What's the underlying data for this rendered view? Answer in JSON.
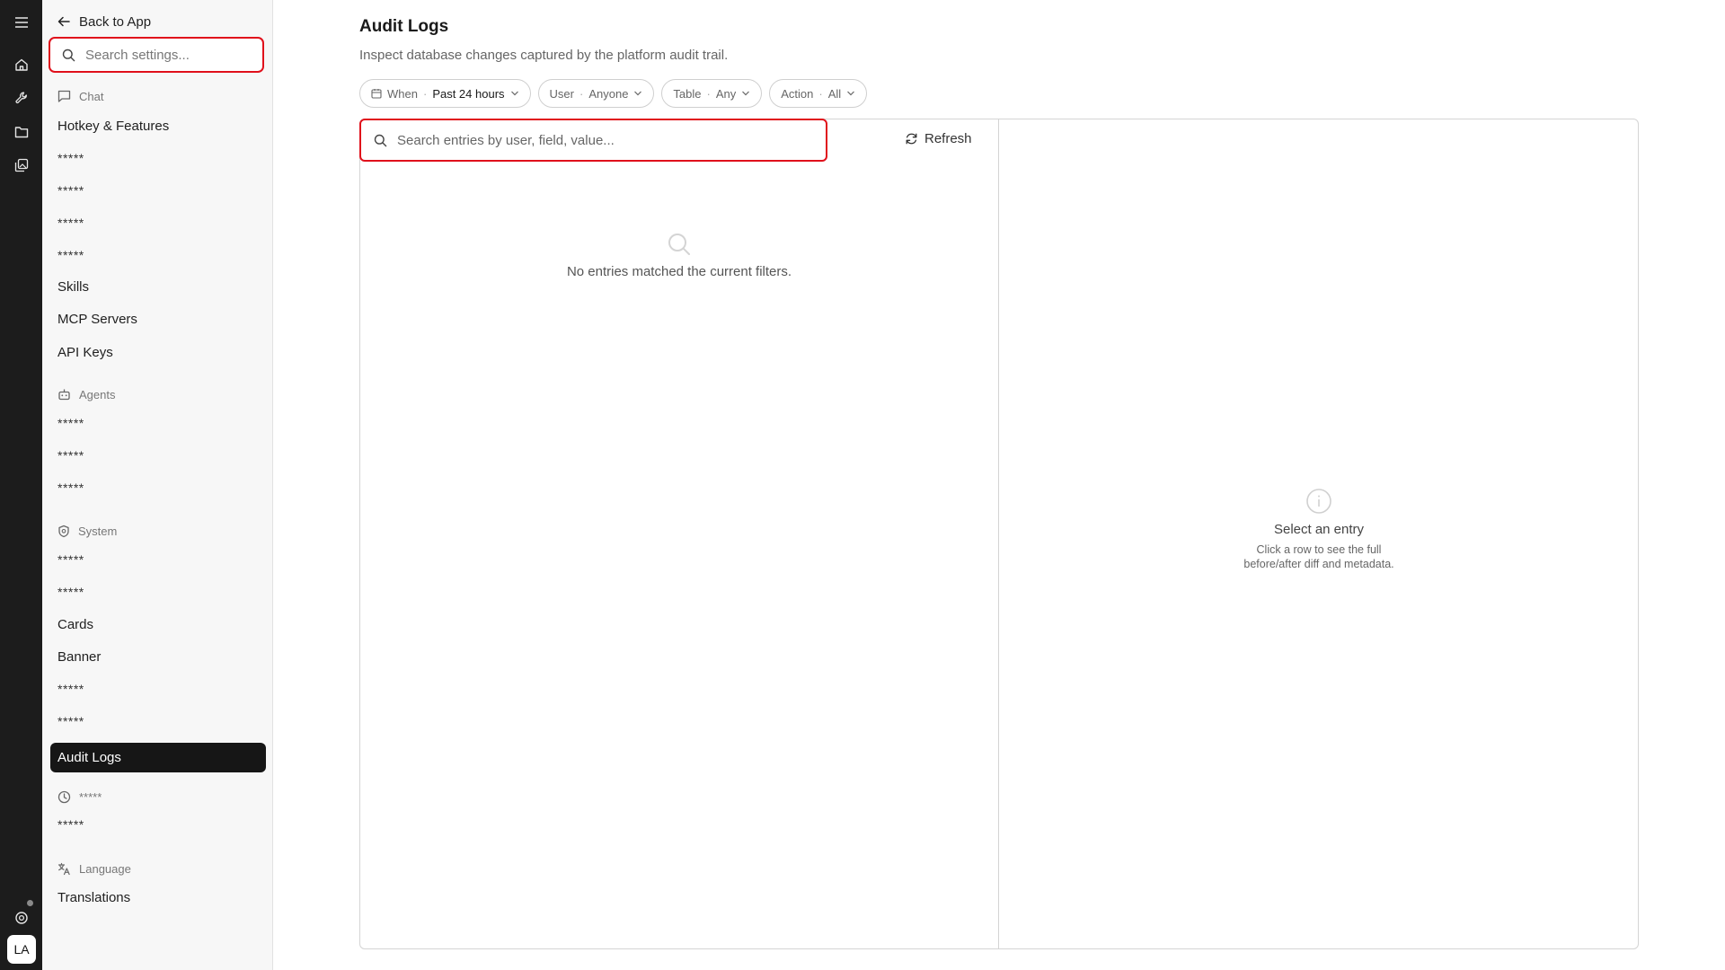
{
  "rail": {
    "icons": [
      "menu-icon",
      "home-icon",
      "wrench-icon",
      "folder-icon",
      "gallery-icon"
    ],
    "help_icon": "help-icon",
    "avatar_initials": "LA"
  },
  "sidebar": {
    "back_label": "Back to App",
    "search_placeholder": "Search settings...",
    "sections": [
      {
        "label": "Chat",
        "icon": "chat-icon",
        "items": [
          "Hotkey & Features",
          "*****",
          "*****",
          "*****",
          "*****",
          "Skills",
          "MCP Servers",
          "API Keys"
        ]
      },
      {
        "label": "Agents",
        "icon": "robot-icon",
        "items": [
          "*****",
          "*****",
          "*****"
        ]
      },
      {
        "label": "System",
        "icon": "shield-icon",
        "items": [
          "*****",
          "*****",
          "Cards",
          "Banner",
          "*****",
          "*****",
          "Audit Logs"
        ]
      },
      {
        "label": "*****",
        "icon": "clock-icon",
        "items": [
          "*****"
        ]
      },
      {
        "label": "Language",
        "icon": "translate-icon",
        "items": [
          "Translations"
        ]
      }
    ],
    "active_item": "Audit Logs"
  },
  "main": {
    "title": "Audit Logs",
    "subtitle": "Inspect database changes captured by the platform audit trail.",
    "filters": [
      {
        "label": "When",
        "value": "Past 24 hours",
        "icon": "calendar-icon"
      },
      {
        "label": "User",
        "value": "Anyone"
      },
      {
        "label": "Table",
        "value": "Any"
      },
      {
        "label": "Action",
        "value": "All"
      }
    ],
    "list": {
      "search_placeholder": "Search entries by user, field, value...",
      "refresh_label": "Refresh",
      "empty_text": "No entries matched the current filters."
    },
    "detail": {
      "heading": "Select an entry",
      "text": "Click a row to see the full before/after diff and metadata."
    }
  }
}
